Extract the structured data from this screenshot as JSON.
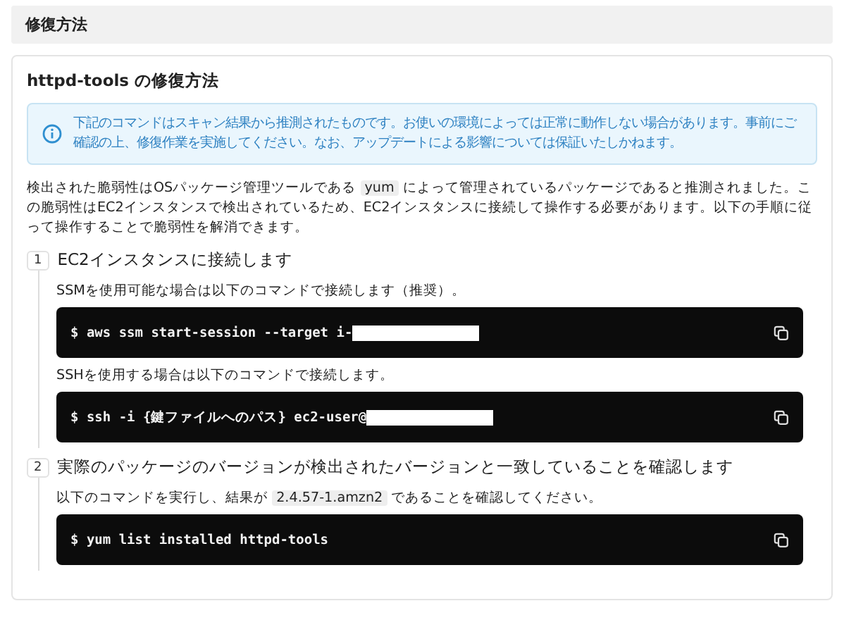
{
  "section_title": "修復方法",
  "card": {
    "title": "httpd-tools の修復方法",
    "notice": "下記のコマンドはスキャン結果から推測されたものです。お使いの環境によっては正常に動作しない場合があります。事前にご確認の上、修復作業を実施してください。なお、アップデートによる影響については保証いたしかねます。",
    "intro": [
      {
        "kind": "text",
        "text": "検出された脆弱性はOSパッケージ管理ツールである"
      },
      {
        "kind": "code",
        "text": "yum"
      },
      {
        "kind": "text",
        "text": "によって管理されているパッケージであると推測されました。この脆弱性はEC2インスタンスで検出されているため、EC2インスタンスに接続して操作する必要があります。以下の手順に従って操作することで脆弱性を解消できます。"
      }
    ],
    "steps": [
      {
        "number": "1",
        "title": "EC2インスタンスに接続します",
        "blocks": [
          {
            "kind": "note",
            "parts": [
              {
                "kind": "text",
                "text": "SSMを使用可能な場合は以下のコマンドで接続します（推奨）。"
              }
            ]
          },
          {
            "kind": "command",
            "text": "$ aws ssm start-session --target i-",
            "redacted": true
          },
          {
            "kind": "note",
            "parts": [
              {
                "kind": "text",
                "text": "SSHを使用する場合は以下のコマンドで接続します。"
              }
            ]
          },
          {
            "kind": "command",
            "text": "$ ssh -i {鍵ファイルへのパス} ec2-user@",
            "redacted": true
          }
        ]
      },
      {
        "number": "2",
        "title": "実際のパッケージのバージョンが検出されたバージョンと一致していることを確認します",
        "blocks": [
          {
            "kind": "note",
            "parts": [
              {
                "kind": "text",
                "text": "以下のコマンドを実行し、結果が"
              },
              {
                "kind": "code",
                "text": "2.4.57-1.amzn2"
              },
              {
                "kind": "text",
                "text": "であることを確認してください。"
              }
            ]
          },
          {
            "kind": "command",
            "text": "$ yum list installed httpd-tools",
            "redacted": false
          }
        ]
      }
    ]
  }
}
